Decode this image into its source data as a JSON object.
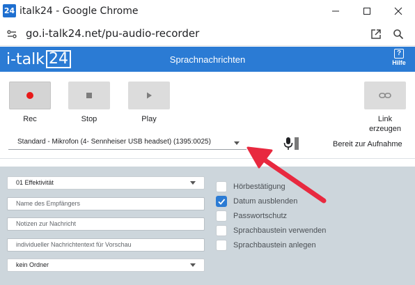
{
  "window": {
    "icon_text": "24",
    "title": "italk24 - Google Chrome",
    "minimize": "—",
    "maximize": "☐",
    "close": "✕"
  },
  "address_bar": {
    "url": "go.i-talk24.net/pu-audio-recorder"
  },
  "app": {
    "logo_text": "i-talk",
    "logo_number": "24",
    "title": "Sprachnachrichten",
    "help_icon": "?",
    "help_label": "Hilfe",
    "brand_color": "#2b7bd4"
  },
  "recorder": {
    "rec_label": "Rec",
    "stop_label": "Stop",
    "play_label": "Play",
    "link_label_line1": "Link",
    "link_label_line2": "erzeugen",
    "mic_device": "Standard - Mikrofon (4- Sennheiser USB headset) (1395:0025)",
    "status": "Bereit zur Aufnahme",
    "rec_color": "#e81919"
  },
  "form": {
    "category": "01 Effektivität",
    "recipient_placeholder": "Name des Empfängers",
    "notes_placeholder": "Notizen zur Nachricht",
    "preview_placeholder": "individueller Nachrichtentext für Vorschau",
    "folder": "kein Ordner"
  },
  "options": [
    {
      "label": "Hörbestätigung",
      "checked": false
    },
    {
      "label": "Datum ausblenden",
      "checked": true
    },
    {
      "label": "Passwortschutz",
      "checked": false
    },
    {
      "label": "Sprachbaustein verwenden",
      "checked": false
    },
    {
      "label": "Sprachbaustein anlegen",
      "checked": false
    }
  ],
  "annotation": {
    "arrow_color": "#e8293f"
  }
}
